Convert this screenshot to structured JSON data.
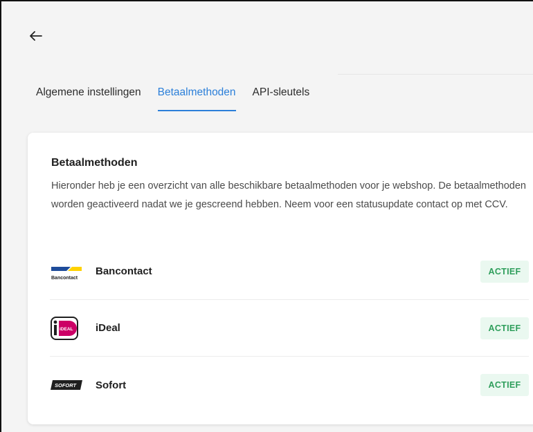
{
  "header": {
    "back_icon": "arrow-left-icon"
  },
  "tabs": [
    {
      "label": "Algemene instellingen",
      "active": false
    },
    {
      "label": "Betaalmethoden",
      "active": true
    },
    {
      "label": "API-sleutels",
      "active": false
    }
  ],
  "card": {
    "title": "Betaalmethoden",
    "description": "Hieronder heb je een overzicht van alle beschikbare betaalmethoden voor je webshop. De betaalmethoden worden geactiveerd nadat we je gescreend hebben. Neem voor een statusupdate contact op met CCV."
  },
  "payment_methods": [
    {
      "name": "Bancontact",
      "status": "ACTIEF",
      "logo_text": "Bancontact",
      "icon": "bancontact-logo"
    },
    {
      "name": "iDeal",
      "status": "ACTIEF",
      "logo_text": "iDEAL",
      "icon": "ideal-logo"
    },
    {
      "name": "Sofort",
      "status": "ACTIEF",
      "logo_text": "SOFORT",
      "icon": "sofort-logo"
    }
  ],
  "colors": {
    "accent": "#2b7fd9",
    "badge_bg": "#eaf8f0",
    "badge_text": "#2e9e5b",
    "bancontact_blue": "#1e4c9a",
    "bancontact_yellow": "#ffd200",
    "ideal_pink": "#cc0066"
  }
}
